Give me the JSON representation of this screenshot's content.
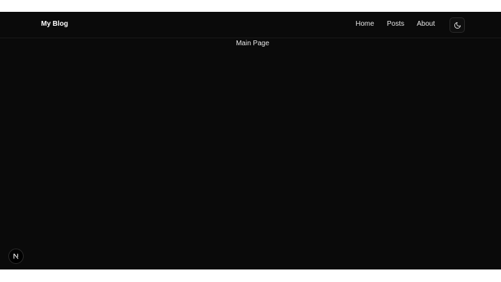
{
  "header": {
    "brand": "My Blog",
    "nav": [
      {
        "label": "Home"
      },
      {
        "label": "Posts"
      },
      {
        "label": "About"
      }
    ],
    "theme_toggle_icon": "moon-icon"
  },
  "main": {
    "text": "Main Page"
  },
  "dev_badge": {
    "icon": "nextjs-logo-icon",
    "letter": "N"
  },
  "colors": {
    "background": "#0a0a0a",
    "text": "#e8e8e8",
    "border": "#1a1a1a"
  }
}
